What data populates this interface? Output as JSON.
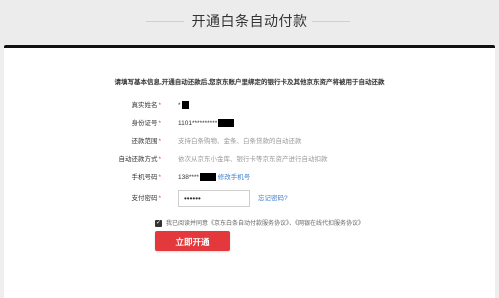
{
  "header": {
    "title": "开通白条自动付款"
  },
  "form": {
    "instruction": "请填写基本信息,开通自动还款后,您京东账户里绑定的银行卡及其他京东资产将被用于自动还款",
    "rows": [
      {
        "label": "真实姓名",
        "required": "*",
        "value": "*"
      },
      {
        "label": "身份证号",
        "required": "*",
        "value": "1101**********"
      },
      {
        "label": "还款范围",
        "required": "*",
        "value": "支持白条购物、金条、白条贷款的自动还款"
      },
      {
        "label": "自动还款方式",
        "required": "*",
        "value": "依次从京东小金库、银行卡等京东资产进行自动扣款"
      },
      {
        "label": "手机号码",
        "required": "*",
        "value": "138****",
        "link": "修改手机号"
      },
      {
        "label": "支付密码",
        "required": "*",
        "password": "••••••",
        "link": "忘记密码?"
      }
    ],
    "agreement": {
      "checked": "✓",
      "text": "我已阅读并同意《京东白条自动付款服务协议》、《网银在线代扣服务协议》"
    },
    "submit_label": "立即开通"
  },
  "colors": {
    "accent": "#e4393c",
    "link": "#3b7fcf"
  }
}
